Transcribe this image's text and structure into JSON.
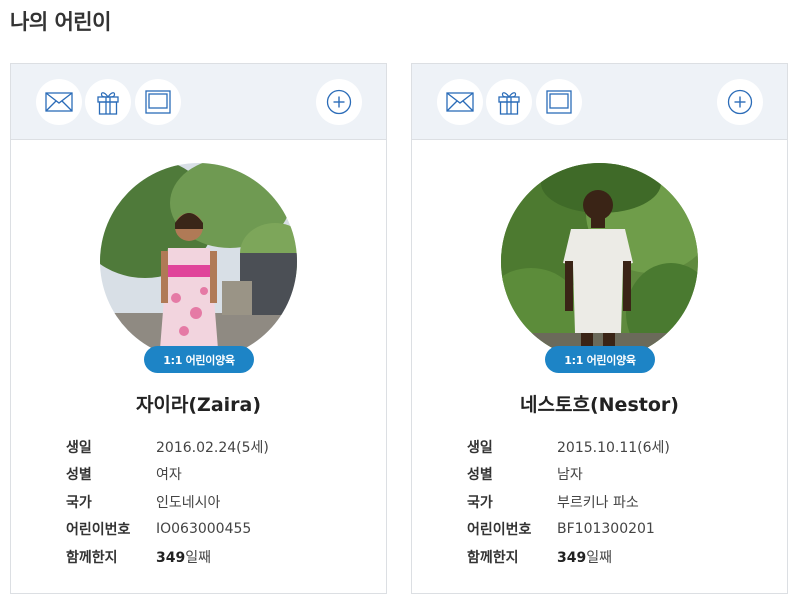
{
  "page": {
    "title": "나의 어린이"
  },
  "labels": {
    "birth": "생일",
    "gender": "성별",
    "country": "국가",
    "child_no": "어린이번호",
    "together": "함께한지"
  },
  "icons": {
    "letter": "envelope-icon",
    "gift": "gift-icon",
    "frame": "photo-frame-icon",
    "add": "plus-circle-icon"
  },
  "colors": {
    "accent": "#1d84c6",
    "toolbar_bg": "#eef2f7",
    "icon_stroke": "#2b6cb8"
  },
  "children": [
    {
      "badge": "1:1 어린이양육",
      "name": "자이라(Zaira)",
      "birth": "2016.02.24(5세)",
      "gender": "여자",
      "country": "인도네시아",
      "child_no": "IO063000455",
      "days_number": "349",
      "days_unit": "일째"
    },
    {
      "badge": "1:1 어린이양육",
      "name": "네스토흐(Nestor)",
      "birth": "2015.10.11(6세)",
      "gender": "남자",
      "country": "부르키나 파소",
      "child_no": "BF101300201",
      "days_number": "349",
      "days_unit": "일째"
    }
  ]
}
